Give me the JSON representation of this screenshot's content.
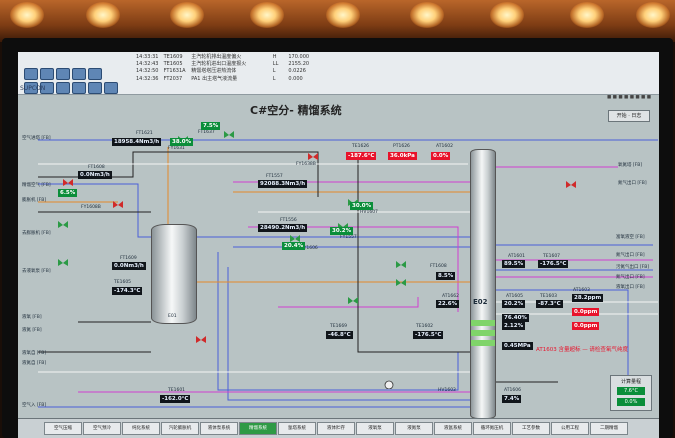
{
  "header": {
    "brand": "SUPCON",
    "title": "C#空分- 精馏系统",
    "operation_button": "开始 · 日志"
  },
  "alarm_log": [
    {
      "time": "14:33:31",
      "tag": "TE1609",
      "desc": "主汽轮机排出温度偏火",
      "level": "H",
      "value": "170.000"
    },
    {
      "time": "14:32:43",
      "tag": "TE1605",
      "desc": "主汽轮机进出口温度报火",
      "level": "LL",
      "value": "2155.20"
    },
    {
      "time": "14:32:50",
      "tag": "FT1631A",
      "desc": "精馏塔塔压进热流体",
      "level": "L",
      "value": "0.0226"
    },
    {
      "time": "14:32:36",
      "tag": "FT2037",
      "desc": "PA1 出主塔气液流量",
      "level": "L",
      "value": "0.000"
    }
  ],
  "instruments": {
    "ft1621": {
      "tag": "FT1621",
      "value": "18958.4Nm3/h"
    },
    "fv1631": {
      "tag": "FY1631",
      "value": "38.0%"
    },
    "ft1637": {
      "tag": "FT1637",
      "value": "7.5%"
    },
    "te1626": {
      "tag": "TE1626",
      "value": "-187.6°C"
    },
    "pt1626": {
      "tag": "PT1626",
      "value": "36.0kPa"
    },
    "at1602": {
      "tag": "AT1602",
      "value": "0.0%"
    },
    "fy1638": {
      "tag": "FY1638B",
      "value": ""
    },
    "ft1608": {
      "tag": "FT1608",
      "value": "0.0Nm3/h"
    },
    "fy1608b": {
      "tag": "FY1608B",
      "value": "6.5%"
    },
    "ft1557": {
      "tag": "FT1557",
      "value": "92088.3Nm3/h"
    },
    "ft1556": {
      "tag": "FT1556",
      "value": "28490.2Nm3/h"
    },
    "hv1607": {
      "tag": "HV1607",
      "value": "30.0%"
    },
    "fy1557": {
      "tag": "FY1557",
      "value": "30.2%"
    },
    "fy1606": {
      "tag": "FY1606",
      "value": "20.4%"
    },
    "ft1609": {
      "tag": "FT1609",
      "value": "0.0Nm3/h"
    },
    "te1605": {
      "tag": "TE1605",
      "value": "-174.3°C"
    },
    "at1601": {
      "tag": "AT1601",
      "value": "89.5%"
    },
    "ft1608x": {
      "tag": "FT1608",
      "value": "8.5%"
    },
    "te1607": {
      "tag": "TE1607",
      "value": "-176.5°C"
    },
    "at1605": {
      "tag": "AT1605",
      "value": "20.2%"
    },
    "te1603": {
      "tag": "TE1603",
      "value": "-87.3°C"
    },
    "ppm1": {
      "tag": "AT1603",
      "value": "28.2ppm"
    },
    "ppm2": {
      "tag": "AT1604",
      "value": "0.0ppm"
    },
    "at1662": {
      "tag": "AT1662",
      "value": "22.6%"
    },
    "pct76": {
      "tag": "AT1606",
      "value": "76.40%"
    },
    "pct2": {
      "tag": "AT1609",
      "value": "2.12%"
    },
    "ppm3": {
      "tag": "AT1610",
      "value": "0.0ppm"
    },
    "kpa": {
      "tag": "PT1609",
      "value": "0.45MPa"
    },
    "te1669": {
      "tag": "TE1669",
      "value": "-46.8°C"
    },
    "te1602": {
      "tag": "TE1602",
      "value": "-176.5°C"
    },
    "te1601": {
      "tag": "TE1601",
      "value": "-162.0°C"
    },
    "at1606b": {
      "tag": "AT1606",
      "value": "7.4%"
    },
    "hv1603": {
      "tag": "HV1603",
      "value": "0.0%"
    }
  },
  "side_labels_left": [
    "空气进塔 [FB]",
    "精馏空气 [FB]",
    "膨胀机 [FB]",
    "去膨胀机 [FB]",
    "去液氧泵 [FB]",
    "液氧 [FB]",
    "液氮 [FB]",
    "液氧自 [FB]",
    "液氮自 [FB]",
    "空气入 [FB]"
  ],
  "side_labels_right": [
    "氧氮塔 [FB]",
    "氮气出口 [FB]",
    "富氧液空 [FB]",
    "氮气出口 [FB]",
    "污氮气出口 [FB]",
    "氮气出口 [FB]",
    "液氧出口 [FB]"
  ],
  "equipment": {
    "column": "E02",
    "tank": "E01"
  },
  "warning": "AT1603 含量超标 — 请检查氧气纯度",
  "calc_panel": {
    "title": "计算量程",
    "v1": "7.6°C",
    "v2": "0.0%"
  },
  "navbar": [
    "空气压缩",
    "空气预冷",
    "纯化系统",
    "汽轮膨胀机",
    "液体泵系统",
    "精馏系统",
    "氩塔系统",
    "液体贮存",
    "液氧泵",
    "液氮泵",
    "液氩系统",
    "循环氮压机",
    "工艺参数",
    "公用工程",
    "二期精馏"
  ],
  "navbar_active_index": 5,
  "colors": {
    "value_red": "#e8132b",
    "value_green": "#0b8e3a",
    "value_black": "#10151a",
    "accent": "#2e9a45"
  }
}
